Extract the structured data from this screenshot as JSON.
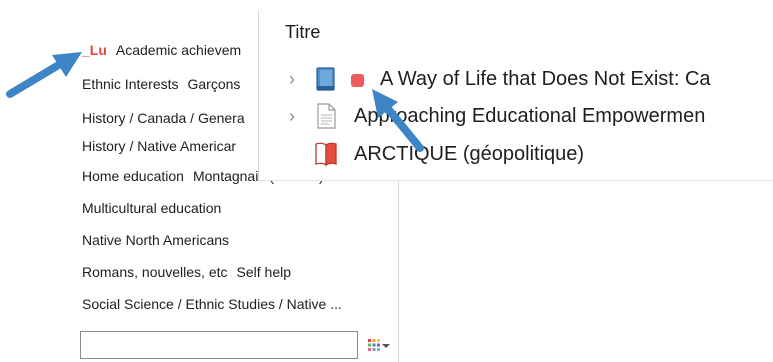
{
  "tag_panel": {
    "rows": [
      [
        {
          "label": "_Lu",
          "colored": true
        },
        {
          "label": "Academic achievem",
          "colored": false
        }
      ],
      [
        {
          "label": "Ethnic Interests",
          "colored": false
        },
        {
          "label": "Garçons",
          "colored": false
        }
      ],
      [
        {
          "label": "History / Canada / Genera",
          "colored": false
        }
      ],
      [
        {
          "label": "History / Native Americar",
          "colored": false
        }
      ],
      [
        {
          "label": "Home education",
          "colored": false
        },
        {
          "label": "Montagnais (Indiens)",
          "colored": false
        }
      ],
      [
        {
          "label": "Multicultural education",
          "colored": false
        }
      ],
      [
        {
          "label": "Native North Americans",
          "colored": false
        }
      ],
      [
        {
          "label": "Romans, nouvelles, etc",
          "colored": false
        },
        {
          "label": "Self help",
          "colored": false
        }
      ],
      [
        {
          "label": "Social Science / Ethnic Studies / Native ...",
          "colored": false
        }
      ]
    ],
    "filter_value": "",
    "menu_icon": "tag-selector-menu-icon",
    "tag_color": "#e8423a"
  },
  "items_pane": {
    "column_header": "Titre",
    "items": [
      {
        "title": "A Way of Life that Does Not Exist: Ca",
        "icon": "book-icon",
        "has_children": true,
        "colored_tag": true
      },
      {
        "title": "Approaching Educational Empowermen",
        "icon": "document-icon",
        "has_children": true,
        "colored_tag": false
      },
      {
        "title": "ARCTIQUE (géopolitique)",
        "icon": "book-section-icon",
        "has_children": false,
        "colored_tag": false
      }
    ],
    "tag_dot_color": "#ef5a5a"
  },
  "annotation_arrow_color": "#3d85c6"
}
